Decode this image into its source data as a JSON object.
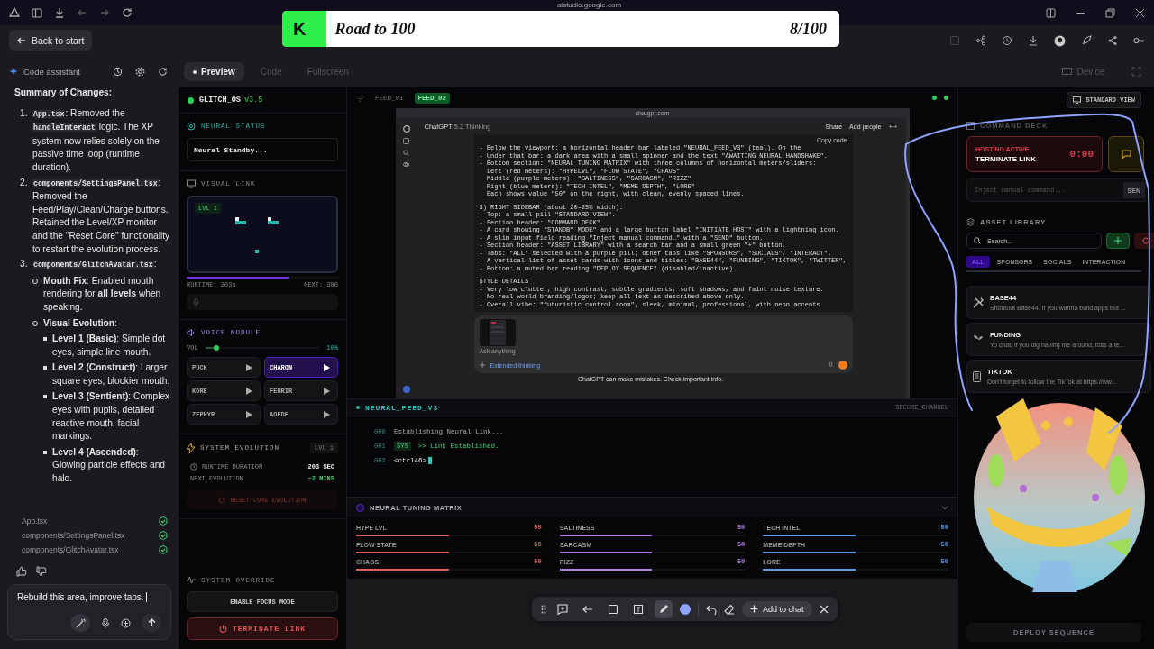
{
  "browser": {
    "url": "aistudio.google.com"
  },
  "banner": {
    "badge": "K",
    "title": "Road to 100",
    "count": "8/100",
    "level": 0.08
  },
  "back_button": "Back to start",
  "assistant": {
    "title": "Code assistant",
    "heading": "Summary of Changes:",
    "changes": [
      {
        "number": "1.",
        "parts": [
          {
            "kind": "code",
            "text": "App.tsx"
          },
          {
            "kind": "text",
            "text": ": Removed the "
          },
          {
            "kind": "code",
            "text": "handleInteract"
          },
          {
            "kind": "text",
            "text": " logic. The XP system now relies solely on the passive time loop (runtime duration)."
          }
        ]
      },
      {
        "number": "2.",
        "parts": [
          {
            "kind": "code",
            "text": "components/SettingsPanel.tsx"
          },
          {
            "kind": "text",
            "text": ": Removed the Feed/Play/Clean/Charge buttons. Retained the Level/XP monitor and the \"Reset Core\" functionality to restart the evolution process."
          }
        ]
      },
      {
        "number": "3.",
        "parts": [
          {
            "kind": "code",
            "text": "components/GlitchAvatar.tsx"
          },
          {
            "kind": "text",
            "text": ":"
          }
        ],
        "children": [
          {
            "text": "**Mouth Fix**: Enabled mouth rendering for **all levels** when speaking."
          },
          {
            "text": "**Visual Evolution**:",
            "children": [
              {
                "text": "**Level 1 (Basic)**: Simple dot eyes, simple line mouth."
              },
              {
                "text": "**Level 2 (Construct)**: Larger square eyes, blockier mouth."
              },
              {
                "text": "**Level 3 (Sentient)**: Complex eyes with pupils, detailed reactive mouth, facial markings."
              },
              {
                "text": "**Level 4 (Ascended)**: Glowing particle effects and halo."
              }
            ]
          }
        ]
      }
    ],
    "files": [
      {
        "name": "App.tsx",
        "done": true
      },
      {
        "name": "components/SettingsPanel.tsx",
        "done": true
      },
      {
        "name": "components/GlitchAvatar.tsx",
        "done": true
      }
    ],
    "input": "Rebuild this area, improve tabs."
  },
  "preview_tabs": [
    {
      "label": "Preview",
      "selected": true
    },
    {
      "label": "Code",
      "selected": false
    },
    {
      "label": "Fullscreen",
      "selected": false
    }
  ],
  "device": "Device",
  "app": {
    "name": "GLITCH_OS",
    "version": "v3.5",
    "view_button": "STANDARD VIEW",
    "neural_status": {
      "title": "NEURAL STATUS",
      "value": "Neural Standby..."
    },
    "visual_link": {
      "title": "VISUAL LINK",
      "badge": "LVL 1",
      "level": 0.68,
      "runtime": "RUNTIME: 203s",
      "next": "NEXT: 300"
    },
    "voice": {
      "title": "VOICE MODULE",
      "vol_label": "VOL",
      "level": 0.1,
      "vol_value": "10%",
      "voices": [
        {
          "name": "PUCK",
          "selected": false
        },
        {
          "name": "CHARON",
          "selected": true
        },
        {
          "name": "KORE",
          "selected": false
        },
        {
          "name": "FENRIR",
          "selected": false
        },
        {
          "name": "ZEPHYR",
          "selected": false
        },
        {
          "name": "AOEDE",
          "selected": false
        }
      ]
    },
    "evolution": {
      "title": "SYSTEM EVOLUTION",
      "badge": "LVL 1",
      "rows": [
        {
          "label": "RUNTIME DURATION",
          "value": "203 SEC"
        },
        {
          "label": "NEXT EVOLUTION",
          "value": "~2 MINS"
        }
      ],
      "reset": "RESET CORE EVOLUTION"
    },
    "override": {
      "title": "SYSTEM OVERRIDE",
      "focus": "ENABLE FOCUS MODE",
      "terminate": "TERMINATE LINK"
    },
    "feed_tabs": [
      {
        "label": "FEED_01",
        "selected": false
      },
      {
        "label": "FEED_02",
        "selected": true
      }
    ],
    "capture": {
      "url": "chatgpt.com",
      "model": "ChatGPT",
      "model_sub": "5.2 Thinking",
      "share": "Share",
      "add_people": "Add people",
      "copy": "Copy code",
      "blocks": [
        [
          "- Below the viewport: a horizontal header bar labeled \"NEURAL_FEED_V3\" (teal). On the",
          "- Under that bar: a dark area with a small spinner and the text \"AWAITING NEURAL HANDSHAKE\".",
          "- Bottom section: \"NEURAL TUNING MATRIX\" with three columns of horizontal meters/sliders:",
          "  Left (red meters): \"HYPELVL\", \"FLOW STATE\", \"CHAOS\"",
          "  Middle (purple meters): \"SALTINESS\", \"SARCASM\", \"RIZZ\"",
          "  Right (blue meters): \"TECH INTEL\", \"MEME DEPTH\", \"LORE\"",
          "  Each shows value \"50\" on the right, with clean, evenly spaced lines."
        ],
        [
          "3) RIGHT SIDEBAR (about 20–25% width):",
          "- Top: a small pill \"STANDARD VIEW\".",
          "- Section header: \"COMMAND DECK\".",
          "- A card showing \"STANDBY MODE\" and a large button label \"INITIATE HOST\" with a lightning icon.",
          "- A slim input field reading \"Inject manual command…\" with a \"SEND\" button.",
          "- Section header: \"ASSET LIBRARY\" with a search bar and a small green \"+\" button.",
          "- Tabs: \"ALL\" selected with a purple pill; other tabs like \"SPONSORS\", \"SOCIALS\", \"INTERACT\".",
          "- A vertical list of asset cards with icons and titles: \"BASE44\", \"FUNDING\", \"TIKTOK\", \"TWITTER\",",
          "- Bottom: a muted bar reading \"DEPLOY SEQUENCE\" (disabled/inactive)."
        ],
        [
          "STYLE DETAILS",
          "- Very low clutter, high contrast, subtle gradients, soft shadows, and faint noise texture.",
          "- No real-world branding/logos; keep all text as described above only.",
          "- Overall vibe: \"futuristic control room\", sleek, minimal, professional, with neon accents."
        ]
      ],
      "placeholder": "Ask anything",
      "mode": "Extended thinking",
      "footer": "ChatGPT can make mistakes. Check important info."
    },
    "console": {
      "title": "NEURAL_FEED_V3",
      "channel": "SECURE_CHANNEL",
      "lines": [
        {
          "num": "000",
          "kind": "plain",
          "text": "Establishing Neural Link..."
        },
        {
          "num": "001",
          "kind": "sys",
          "tag": "SYS",
          "text": ">> Link Established."
        },
        {
          "num": "002",
          "kind": "input",
          "text": "<ctrl46>"
        }
      ]
    },
    "tuning": {
      "title": "NEURAL TUNING MATRIX",
      "groups": [
        {
          "color": "#e45f5f",
          "meters": [
            {
              "label": "HYPE LVL",
              "value": "50",
              "level": 0.5
            },
            {
              "label": "FLOW STATE",
              "value": "50",
              "level": 0.5
            },
            {
              "label": "CHAOS",
              "value": "50",
              "level": 0.5
            }
          ]
        },
        {
          "color": "#b07ee8",
          "meters": [
            {
              "label": "SALTINESS",
              "value": "50",
              "level": 0.5
            },
            {
              "label": "SARCASM",
              "value": "50",
              "level": 0.5
            },
            {
              "label": "RIZZ",
              "value": "50",
              "level": 0.5
            }
          ]
        },
        {
          "color": "#5f9be8",
          "meters": [
            {
              "label": "TECH INTEL",
              "value": "50",
              "level": 0.5
            },
            {
              "label": "MEME DEPTH",
              "value": "50",
              "level": 0.5
            },
            {
              "label": "LORE",
              "value": "50",
              "level": 0.5
            }
          ]
        }
      ]
    },
    "command_deck": {
      "title": "COMMAND DECK",
      "status": "HOSTING ACTIVE",
      "action": "TERMINATE LINK",
      "timer": "0:00",
      "placeholder": "Inject manual command...",
      "send": "SEN"
    },
    "assets": {
      "title": "ASSET LIBRARY",
      "placeholder": "Search...",
      "tabs": [
        {
          "label": "ALL",
          "selected": true
        },
        {
          "label": "SPONSORS",
          "selected": false
        },
        {
          "label": "SOCIALS",
          "selected": false
        },
        {
          "label": "INTERACTION",
          "selected": false
        }
      ],
      "items": [
        {
          "kind": "tools",
          "title": "BASE44",
          "desc": "Shoutout Base44. If you wanna build apps but ..."
        },
        {
          "kind": "money",
          "title": "FUNDING",
          "desc": "Yo chat, if you dig having me around, toss a fe..."
        },
        {
          "kind": "phone",
          "title": "TIKTOK",
          "desc": "Don't forget to follow the TikTok at https://ww..."
        }
      ]
    },
    "deploy": "DEPLOY SEQUENCE"
  },
  "toolbar": {
    "tools": [
      {
        "kind": "comment",
        "selected": false
      },
      {
        "kind": "arrow",
        "selected": false
      },
      {
        "kind": "rect",
        "selected": false
      },
      {
        "kind": "text",
        "selected": false
      },
      {
        "kind": "pen",
        "selected": true
      }
    ],
    "color": "#8fa3ff",
    "add": "Add to chat"
  }
}
